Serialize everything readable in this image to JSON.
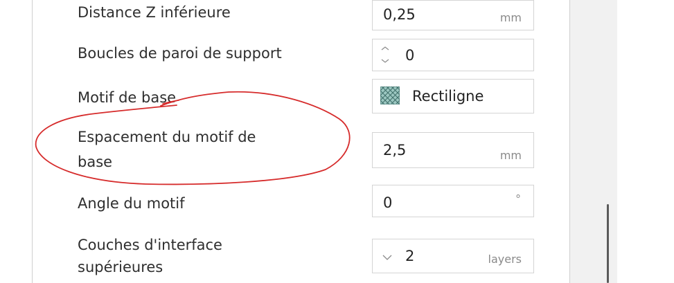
{
  "settings": [
    {
      "label": "Distance Z inférieure",
      "value": "0,25",
      "unit": "mm"
    },
    {
      "label": "Boucles de paroi de support",
      "value": "0",
      "unit": ""
    },
    {
      "label": "Motif de base",
      "value": "Rectiligne",
      "unit": ""
    },
    {
      "label_line1": "Espacement du motif de",
      "label_line2": "base",
      "value": "2,5",
      "unit": "mm"
    },
    {
      "label": "Angle du motif",
      "value": "0",
      "unit": "°"
    },
    {
      "label_line1": "Couches d'interface",
      "label_line2": "supérieures",
      "value": "2",
      "unit": "layers"
    }
  ],
  "colors": {
    "annotation": "#d62b2b",
    "pattern_fill": "#7fb3ad"
  },
  "icons": {
    "spinner": "spinner-arrows-icon",
    "pattern": "rectilinear-pattern-icon",
    "dropdown": "chevron-down-icon"
  }
}
